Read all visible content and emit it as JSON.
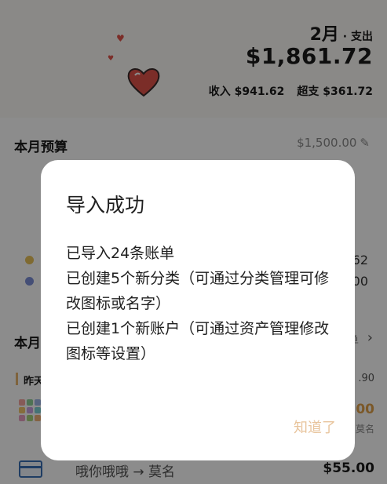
{
  "header": {
    "month": "2月",
    "month_suffix": " · 支出",
    "total": "$1,861.72",
    "income_label": "收入",
    "income_value": "$941.62",
    "over_label": "超支",
    "over_value": "$361.72"
  },
  "budget": {
    "title": "本月预算",
    "amount": "$1,500.00",
    "legend_values": [
      "62",
      "00"
    ]
  },
  "month_list": {
    "title": "本月",
    "more_label": "单",
    "day_label": "昨天",
    "day_total": ".90",
    "row1": {
      "amount": ".00",
      "sub": "莫名"
    },
    "row2": {
      "text": "哦你哦哦 → 莫名",
      "amount": "$55.00"
    }
  },
  "dialog": {
    "title": "导入成功",
    "lines": [
      "已导入24条账单",
      "已创建5个新分类（可通过分类管理可修改图标或名字）",
      "已创建1个新账户（可通过资产管理修改图标等设置）"
    ],
    "button": "知道了"
  },
  "colors": {
    "accent": "#e8c49c",
    "heart": "#e0534a",
    "legend_yellow": "#e7c15a",
    "legend_blue": "#7d8fd8"
  },
  "icons": [
    "heart-icon",
    "edit-icon",
    "chevron-right-icon",
    "category-grid-icon",
    "credit-card-icon"
  ]
}
